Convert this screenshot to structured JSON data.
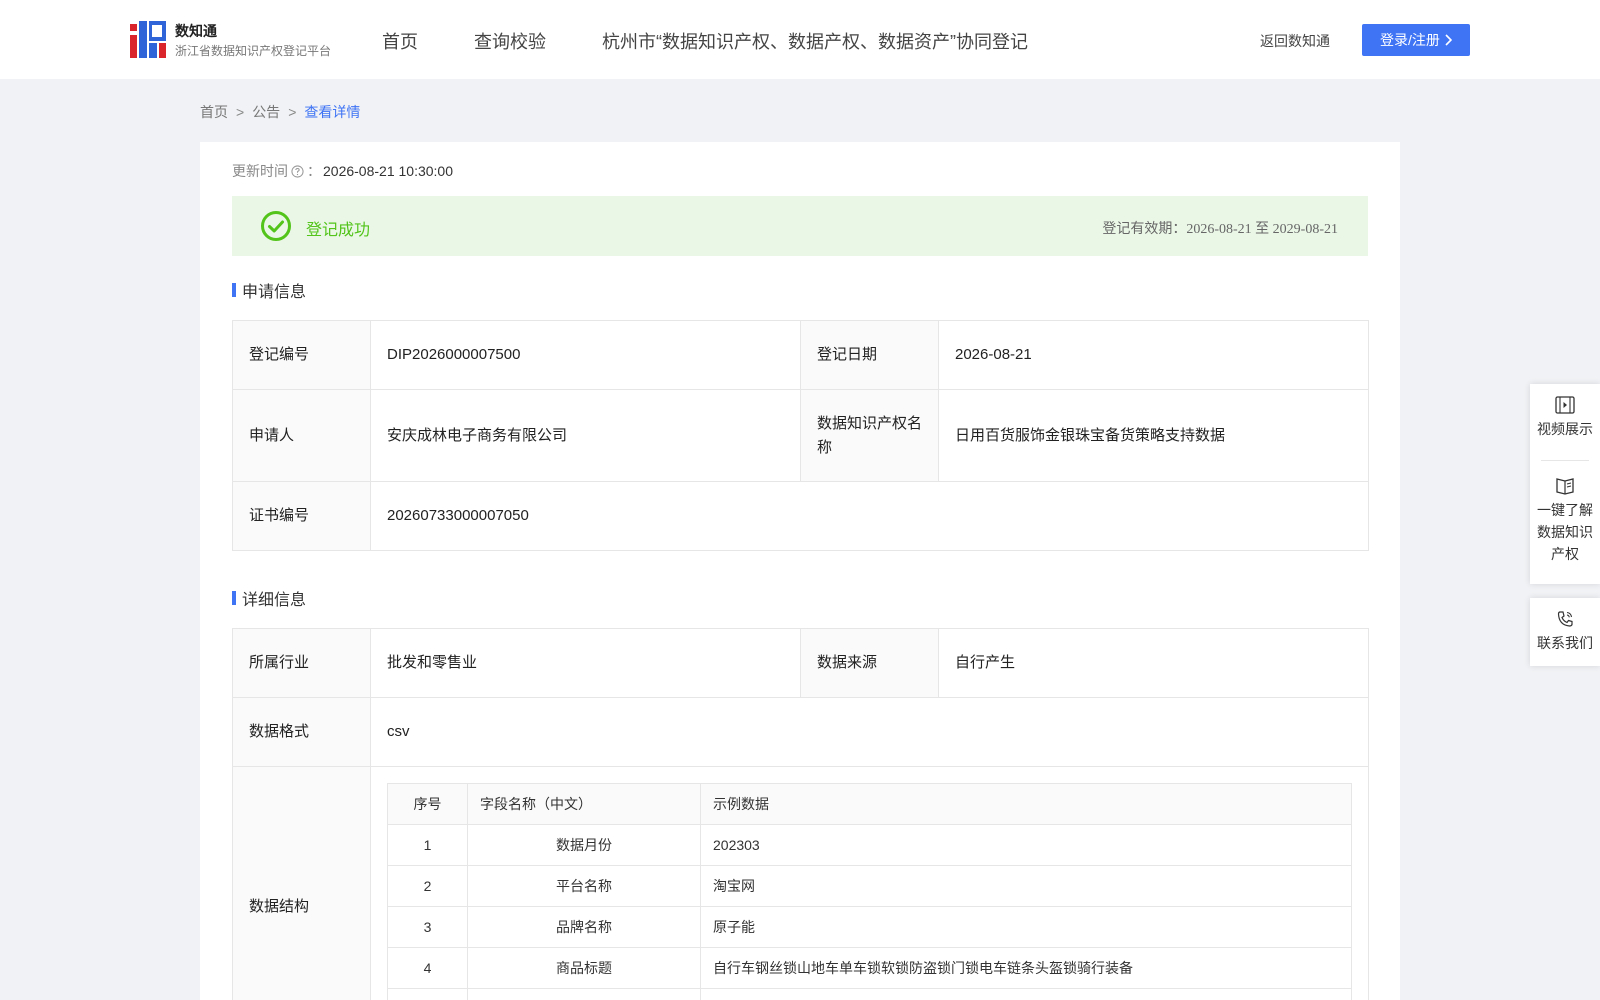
{
  "header": {
    "brand_name": "数知通",
    "brand_sub": "浙江省数据知识产权登记平台",
    "nav": [
      "首页",
      "查询校验",
      "杭州市“数据知识产权、数据产权、数据资产”协同登记"
    ],
    "back_label": "返回数知通",
    "login_label": "登录/注册",
    "accent_color": "#3f74f5"
  },
  "breadcrumb": {
    "items": [
      "首页",
      "公告",
      "查看详情"
    ],
    "separator": ">"
  },
  "update": {
    "label": "更新时间",
    "colon": "：",
    "value": "2026-08-21 10:30:00"
  },
  "status": {
    "text": "登记成功",
    "validity": "登记有效期：2026-08-21 至 2029-08-21",
    "color": "#52c41a"
  },
  "application": {
    "title": "申请信息",
    "reg_no_label": "登记编号",
    "reg_no": "DIP2026000007500",
    "reg_date_label": "登记日期",
    "reg_date": "2026-08-21",
    "applicant_label": "申请人",
    "applicant": "安庆成林电子商务有限公司",
    "name_label": "数据知识产权名称",
    "name": "日用百货服饰金银珠宝备货策略支持数据",
    "cert_label": "证书编号",
    "cert_no": "20260733000007050"
  },
  "details": {
    "title": "详细信息",
    "industry_label": "所属行业",
    "industry": "批发和零售业",
    "source_label": "数据来源",
    "source": "自行产生",
    "format_label": "数据格式",
    "format": "csv",
    "structure_label": "数据结构",
    "structure": {
      "headers": [
        "序号",
        "字段名称（中文）",
        "示例数据"
      ],
      "rows": [
        [
          "1",
          "数据月份",
          "202303"
        ],
        [
          "2",
          "平台名称",
          "淘宝网"
        ],
        [
          "3",
          "品牌名称",
          "原子能"
        ],
        [
          "4",
          "商品标题",
          "自行车钢丝锁山地车单车锁软锁防盗锁门锁电车链条头盔锁骑行装备"
        ],
        [
          "",
          "",
          ""
        ]
      ]
    }
  },
  "float": {
    "video": "视频展示",
    "learn": [
      "一键了解",
      "数据知识",
      "产权"
    ],
    "contact": "联系我们"
  },
  "icons": {
    "question": "question-circle-icon",
    "success": "check-circle-icon",
    "video": "video-icon",
    "book": "book-icon",
    "phone": "phone-icon",
    "chevron": "chevron-right-icon"
  }
}
